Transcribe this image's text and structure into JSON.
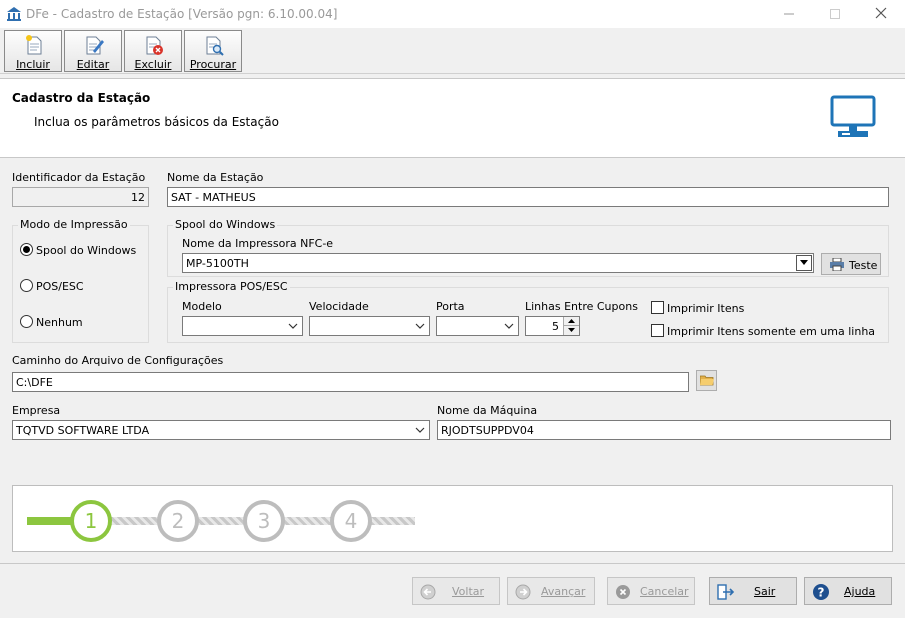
{
  "window": {
    "title": "DFe - Cadastro de Estação [Versão pgn: 6.10.00.04]"
  },
  "toolbar": {
    "incluir": "Incluir",
    "editar": "Editar",
    "excluir": "Excluir",
    "procurar": "Procurar"
  },
  "header": {
    "title": "Cadastro da Estação",
    "subtitle": "Inclua os parâmetros básicos da Estação"
  },
  "form": {
    "id_label": "Identificador da Estação",
    "id_value": "12",
    "name_label": "Nome da Estação",
    "name_value": "SAT - MATHEUS",
    "print_mode": {
      "title": "Modo de Impressão",
      "options": [
        "Spool do Windows",
        "POS/ESC",
        "Nenhum"
      ],
      "selected": "Spool do Windows"
    },
    "spool": {
      "title": "Spool do Windows",
      "printer_label": "Nome da Impressora NFC-e",
      "printer_value": "MP-5100TH",
      "test_button": "Teste"
    },
    "posesc": {
      "title": "Impressora POS/ESC",
      "model_label": "Modelo",
      "speed_label": "Velocidade",
      "port_label": "Porta",
      "lines_label": "Linhas Entre Cupons",
      "lines_value": "5",
      "print_items": "Imprimir Itens",
      "print_items_one_line": "Imprimir Itens somente em uma linha"
    },
    "config_path_label": "Caminho do Arquivo de Configurações",
    "config_path_value": "C:\\DFE",
    "company_label": "Empresa",
    "company_value": "TQTVD SOFTWARE LTDA",
    "machine_label": "Nome da Máquina",
    "machine_value": "RJODTSUPPDV04"
  },
  "wizard": {
    "steps": [
      "1",
      "2",
      "3",
      "4"
    ],
    "current_step": 1
  },
  "buttons": {
    "voltar": "Voltar",
    "avancar": "Avançar",
    "cancelar": "Cancelar",
    "sair": "Sair",
    "ajuda": "Ajuda"
  },
  "colors": {
    "step_active": "#8cc63f",
    "step_inactive": "#bdbdbd",
    "icon_blue": "#1e74b7"
  }
}
